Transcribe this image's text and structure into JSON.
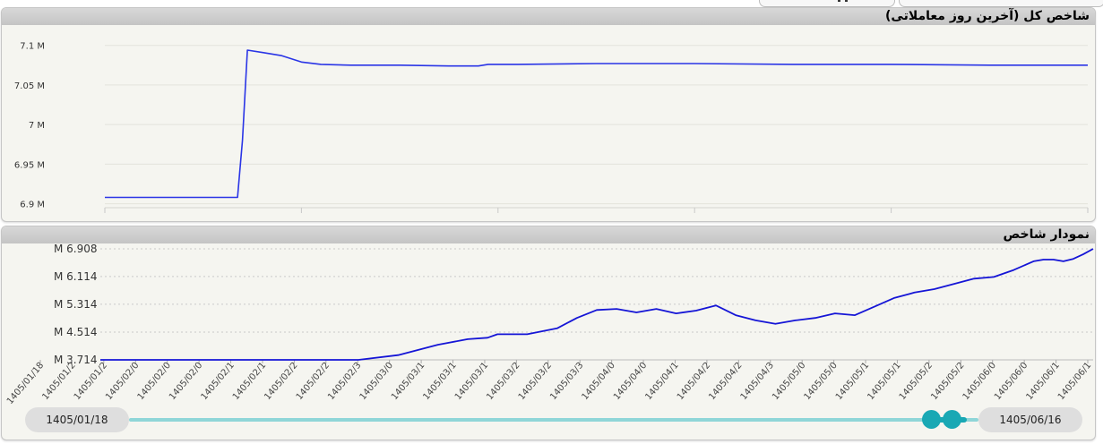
{
  "chart_data": [
    {
      "type": "line",
      "title": "شاخص کل (آخرین روز معاملاتی)",
      "ylim": [
        6.895,
        7.12
      ],
      "y_ticks": [
        {
          "value": 7.1,
          "label": "7.1 M"
        },
        {
          "value": 7.05,
          "label": "7.05 M"
        },
        {
          "value": 7.0,
          "label": "7 M"
        },
        {
          "value": 6.95,
          "label": "6.95 M"
        },
        {
          "value": 6.9,
          "label": "6.9 M"
        }
      ],
      "grid": true,
      "x": [
        0.0,
        0.135,
        0.14,
        0.145,
        0.16,
        0.18,
        0.2,
        0.22,
        0.25,
        0.3,
        0.35,
        0.38,
        0.39,
        0.42,
        0.5,
        0.6,
        0.7,
        0.8,
        0.9,
        1.0
      ],
      "series": [
        {
          "color": "#2a35e6",
          "values": [
            6.908,
            6.908,
            6.98,
            7.094,
            7.091,
            7.087,
            7.079,
            7.076,
            7.075,
            7.075,
            7.074,
            7.074,
            7.076,
            7.076,
            7.077,
            7.077,
            7.076,
            7.076,
            7.075,
            7.075
          ]
        }
      ]
    },
    {
      "type": "line",
      "title": "نمودار شاخص",
      "ylim": [
        3.714,
        6.908
      ],
      "y_ticks": [
        {
          "value": 6.908,
          "label": "M 6.908"
        },
        {
          "value": 6.114,
          "label": "M 6.114"
        },
        {
          "value": 5.314,
          "label": "M 5.314"
        },
        {
          "value": 4.514,
          "label": "M 4.514"
        },
        {
          "value": 3.714,
          "label": "M 3.714"
        }
      ],
      "grid": true,
      "x_tick_labels": [
        "1405/01/18",
        "1405/01/2",
        "1405/01/2",
        "1405/02/0",
        "1405/02/0",
        "1405/02/0",
        "1405/02/1",
        "1405/02/1",
        "1405/02/2",
        "1405/02/2",
        "1405/02/3",
        "1405/03/0",
        "1405/03/1",
        "1405/03/1",
        "1405/03/1",
        "1405/03/2",
        "1405/03/2",
        "1405/03/3",
        "1405/04/0",
        "1405/04/0",
        "1405/04/1",
        "1405/04/2",
        "1405/04/2",
        "1405/04/3",
        "1405/05/0",
        "1405/05/0",
        "1405/05/1",
        "1405/05/1",
        "1405/05/2",
        "1405/05/2",
        "1405/06/0",
        "1405/06/0",
        "1405/06/1",
        "1405/06/1"
      ],
      "x": [
        0.0,
        0.1,
        0.2,
        0.26,
        0.3,
        0.34,
        0.37,
        0.39,
        0.4,
        0.43,
        0.46,
        0.48,
        0.5,
        0.52,
        0.54,
        0.56,
        0.58,
        0.6,
        0.62,
        0.64,
        0.66,
        0.68,
        0.7,
        0.72,
        0.74,
        0.76,
        0.78,
        0.8,
        0.82,
        0.84,
        0.86,
        0.88,
        0.9,
        0.92,
        0.94,
        0.95,
        0.96,
        0.97,
        0.98,
        0.99,
        1.0
      ],
      "series": [
        {
          "color": "#1515d6",
          "values": [
            3.714,
            3.714,
            3.714,
            3.714,
            3.85,
            4.15,
            4.31,
            4.35,
            4.45,
            4.45,
            4.62,
            4.92,
            5.15,
            5.18,
            5.08,
            5.18,
            5.05,
            5.13,
            5.28,
            5.0,
            4.85,
            4.75,
            4.85,
            4.92,
            5.05,
            5.0,
            5.25,
            5.5,
            5.65,
            5.75,
            5.9,
            6.05,
            6.1,
            6.3,
            6.55,
            6.6,
            6.6,
            6.55,
            6.62,
            6.75,
            6.908
          ]
        }
      ]
    }
  ],
  "range": {
    "start_label": "1405/01/18",
    "end_label": "1405/06/16",
    "handle_start": 0.963,
    "handle_end": 0.987
  },
  "colors": {
    "slider_track": "#8fd6d8",
    "slider_handle": "#19a8b4"
  }
}
